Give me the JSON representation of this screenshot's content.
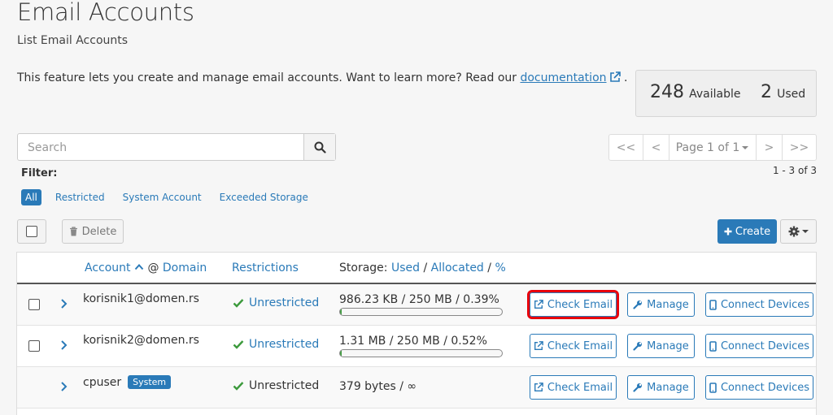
{
  "page": {
    "title": "Email Accounts",
    "subtitle": "List Email Accounts",
    "intro_text": "This feature lets you create and manage email accounts. Want to learn more? Read our ",
    "intro_link": "documentation",
    "intro_end": "."
  },
  "stats": {
    "available_num": "248",
    "available_label": "Available",
    "used_num": "2",
    "used_label": "Used"
  },
  "search": {
    "placeholder": "Search"
  },
  "pagination": {
    "first": "<<",
    "prev": "<",
    "page_label": "Page 1 of 1",
    "next": ">",
    "last": ">>",
    "range": "1 - 3 of 3"
  },
  "filter": {
    "label": "Filter:",
    "options": [
      "All",
      "Restricted",
      "System Account",
      "Exceeded Storage"
    ],
    "active": "All"
  },
  "toolbar": {
    "delete_label": "Delete",
    "create_label": "Create"
  },
  "table": {
    "headers": {
      "account": "Account",
      "at": "@",
      "domain": "Domain",
      "restrictions": "Restrictions",
      "storage": "Storage:",
      "used": "Used",
      "allocated": "Allocated",
      "percent": "%",
      "slash": "/"
    },
    "rows": [
      {
        "account": "korisnik1@domen.rs",
        "restriction": "Unrestricted",
        "storage": "986.23 KB / 250 MB / 0.39%",
        "usage_fraction": 0.0039,
        "badge": "",
        "check_email": "Check Email",
        "manage": "Manage",
        "connect": "Connect Devices"
      },
      {
        "account": "korisnik2@domen.rs",
        "restriction": "Unrestricted",
        "storage": "1.31 MB / 250 MB / 0.52%",
        "usage_fraction": 0.0052,
        "badge": "",
        "check_email": "Check Email",
        "manage": "Manage",
        "connect": "Connect Devices"
      },
      {
        "account": "cpuser",
        "restriction": "Unrestricted",
        "storage": "379 bytes / ∞",
        "badge": "System",
        "check_email": "Check Email",
        "manage": "Manage",
        "connect": "Connect Devices"
      }
    ]
  },
  "colors": {
    "accent": "#2a7ab8",
    "success": "#3c9a3c",
    "highlight": "#e8000b"
  }
}
